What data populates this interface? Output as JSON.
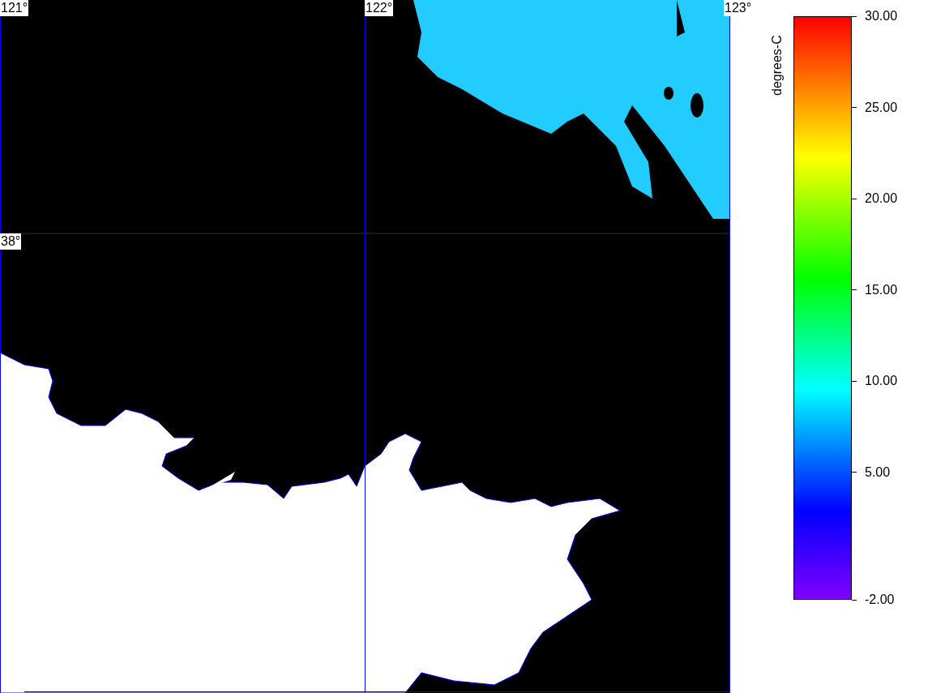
{
  "map": {
    "longitude_labels": [
      "121°",
      "122°",
      "123°"
    ],
    "latitude_labels": [
      "38°"
    ]
  },
  "legend": {
    "title": "degrees-C",
    "tick_labels": [
      "30.00",
      "25.00",
      "20.00",
      "15.00",
      "10.00",
      "5.00",
      "-2.00"
    ]
  }
}
